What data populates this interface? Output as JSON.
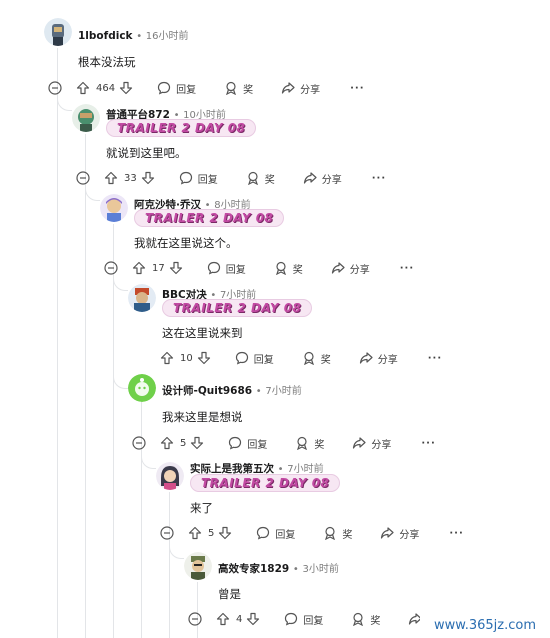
{
  "comments": [
    {
      "user": "1lbofdick",
      "time": "16小时前",
      "flair": "",
      "body": "根本没法玩",
      "votes": "464",
      "reply": "回复",
      "award": "奖",
      "share": "分享",
      "avatar_color": "#5a6b7e"
    },
    {
      "user": "普通平台872",
      "time": "10小时前",
      "flair": "TRAILER 2 DAY 08",
      "body": "就说到这里吧。",
      "votes": "33",
      "reply": "回复",
      "award": "奖",
      "share": "分享",
      "avatar_color": "#4a8f6e"
    },
    {
      "user": "阿克沙特·乔汉",
      "time": "8小时前",
      "flair": "TRAILER 2 DAY 08",
      "body": "我就在这里说这个。",
      "votes": "17",
      "reply": "回复",
      "award": "奖",
      "share": "分享",
      "avatar_color": "#8a6cc9"
    },
    {
      "user": "BBC对决",
      "time": "7小时前",
      "flair": "TRAILER 2 DAY 08",
      "body": "这在这里说来到",
      "votes": "10",
      "reply": "回复",
      "award": "奖",
      "share": "分享",
      "avatar_color": "#2f5d8a"
    },
    {
      "user": "设计师-Quit9686",
      "time": "7小时前",
      "flair": "",
      "body": "我来这里是想说",
      "votes": "5",
      "reply": "回复",
      "award": "奖",
      "share": "分享",
      "avatar_color": "#6fd04a"
    },
    {
      "user": "实际上是我第五次",
      "time": "7小时前",
      "flair": "TRAILER 2 DAY 08",
      "body": "来了",
      "votes": "5",
      "reply": "回复",
      "award": "奖",
      "share": "分享",
      "avatar_color": "#3a3a4a"
    },
    {
      "user": "高效专家1829",
      "time": "3小时前",
      "flair": "",
      "body": "曾是",
      "votes": "4",
      "reply": "回复",
      "award": "奖",
      "share": "分享",
      "avatar_color": "#6a7a4a"
    }
  ],
  "more_label": "···",
  "watermark": "www.365jz.com",
  "sep": "•"
}
